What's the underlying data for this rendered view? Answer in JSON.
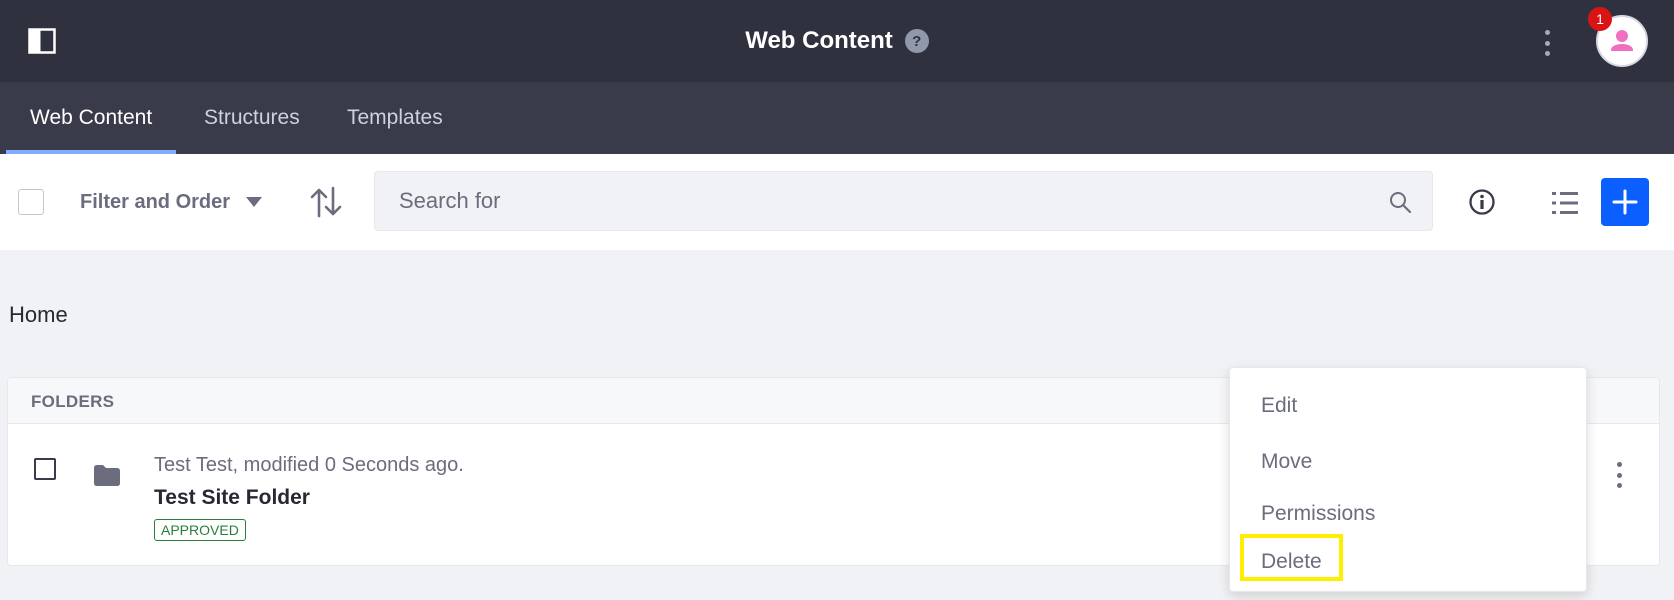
{
  "header": {
    "title": "Web Content",
    "help_glyph": "?",
    "notification_count": "1",
    "icons": [
      "sidebar-toggle-icon",
      "help-icon",
      "kebab-icon",
      "user-avatar-icon"
    ]
  },
  "tabs": [
    {
      "label": "Web Content",
      "active": true
    },
    {
      "label": "Structures",
      "active": false
    },
    {
      "label": "Templates",
      "active": false
    }
  ],
  "toolbar": {
    "filter_label": "Filter and Order",
    "search_placeholder": "Search for",
    "icons": [
      "sort-icon",
      "search-icon",
      "info-icon",
      "list-view-icon",
      "plus-icon"
    ]
  },
  "breadcrumb": "Home",
  "folders": {
    "header": "FOLDERS",
    "rows": [
      {
        "meta": "Test Test, modified 0 Seconds ago.",
        "title": "Test Site Folder",
        "status": "APPROVED"
      }
    ]
  },
  "menu": {
    "items": [
      "Edit",
      "Move",
      "Permissions",
      "Delete"
    ],
    "highlighted": "Delete"
  },
  "colors": {
    "topbar": "#30313f",
    "tabbar": "#393a4a",
    "active_tab_indicator": "#80acff",
    "primary": "#0b5fff",
    "badge_red": "#da1414",
    "approved_green": "#287d3c",
    "highlight_yellow": "#ffee00",
    "avatar_pink": "#f06fbe"
  }
}
